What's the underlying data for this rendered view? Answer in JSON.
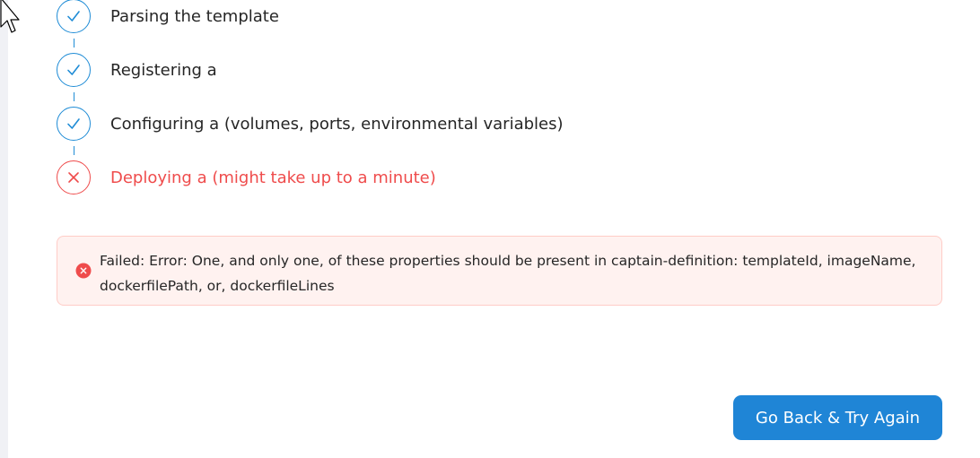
{
  "steps": [
    {
      "label": "Parsing the template",
      "status": "done",
      "icon": "check-icon"
    },
    {
      "label": "Registering a",
      "status": "done",
      "icon": "check-icon"
    },
    {
      "label": "Configuring a (volumes, ports, environmental variables)",
      "status": "done",
      "icon": "check-icon"
    },
    {
      "label": "Deploying a (might take up to a minute)",
      "status": "failed",
      "icon": "close-icon"
    }
  ],
  "alert": {
    "type": "error",
    "icon": "error-icon",
    "message": "Failed: Error: One, and only one, of these properties should be present in captain-definition: templateId, imageName, dockerfilePath, or, dockerfileLines"
  },
  "actions": {
    "retry_label": "Go Back & Try Again"
  },
  "colors": {
    "primary": "#1f85d6",
    "error": "#ef4c4c",
    "alert_background": "#fff2f0",
    "alert_border": "#ffccc7"
  }
}
